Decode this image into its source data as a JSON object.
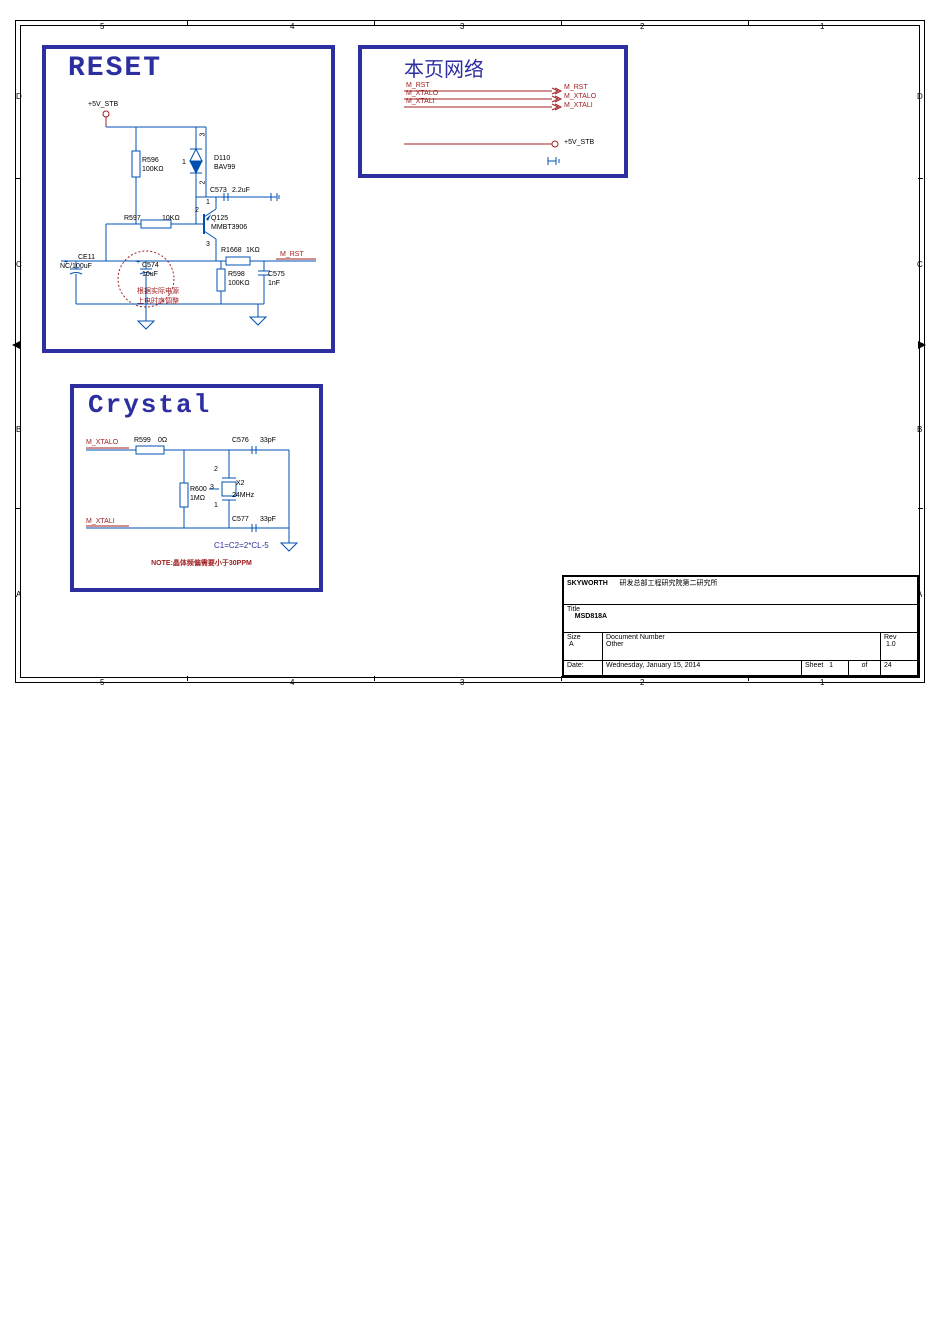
{
  "frame": {
    "cols": [
      "5",
      "4",
      "3",
      "2",
      "1"
    ],
    "rows": [
      "D",
      "C",
      "B",
      "A"
    ]
  },
  "reset": {
    "title": "RESET",
    "power": "+5V_STB",
    "R596": {
      "ref": "R596",
      "val": "100KΩ"
    },
    "D110": {
      "ref": "D110",
      "val": "BAV99"
    },
    "C573": {
      "ref": "C573",
      "val": "2.2uF"
    },
    "R597": {
      "ref": "R597",
      "val": "10KΩ"
    },
    "Q125": {
      "ref": "Q125",
      "val": "MMBT3906"
    },
    "CE11": {
      "ref": "CE11",
      "val": "NC/100uF"
    },
    "C574": {
      "ref": "C574",
      "val": "10uF"
    },
    "R598": {
      "ref": "R598",
      "val": "100KΩ"
    },
    "R1668": {
      "ref": "R1668",
      "val": "1KΩ"
    },
    "C575": {
      "ref": "C575",
      "val": "1nF"
    },
    "net": "M_RST",
    "note": "根据实际电源\n上电时序调整",
    "pins": {
      "d1": "1",
      "d2": "2",
      "d3": "3",
      "q1": "1",
      "q2": "2",
      "q3": "3"
    }
  },
  "crystal": {
    "title": "Crystal",
    "netO": "M_XTALO",
    "netI": "M_XTALI",
    "R599": {
      "ref": "R599",
      "val": "0Ω"
    },
    "R600": {
      "ref": "R600",
      "val": "1MΩ"
    },
    "X2": {
      "ref": "X2",
      "val": "24MHz"
    },
    "C576": {
      "ref": "C576",
      "val": "33pF"
    },
    "C577": {
      "ref": "C577",
      "val": "33pF"
    },
    "eqn": "C1=C2=2*CL-5",
    "note": "NOTE:晶体频偏需要小于30PPM",
    "pins": {
      "x1": "1",
      "x2": "2",
      "x3": "3"
    }
  },
  "netbox": {
    "title": "本页网络",
    "left": [
      "M_RST",
      "M_XTALO",
      "M_XTALI"
    ],
    "right": [
      "M_RST",
      "M_XTALO",
      "M_XTALI"
    ],
    "pwr": "+5V_STB"
  },
  "titleblock": {
    "company": "SKYWORTH",
    "dept": "研发总部工程研究院第二研究所",
    "titleLabel": "Title",
    "title": "MSD818A",
    "sizeLabel": "Size",
    "size": "A",
    "docLabel": "Document Number",
    "doc": "Other",
    "revLabel": "Rev",
    "rev": "1.0",
    "dateLabel": "Date:",
    "date": "Wednesday, January 15, 2014",
    "sheetLabel": "Sheet",
    "sheet": "1",
    "ofLabel": "of",
    "total": "24"
  }
}
